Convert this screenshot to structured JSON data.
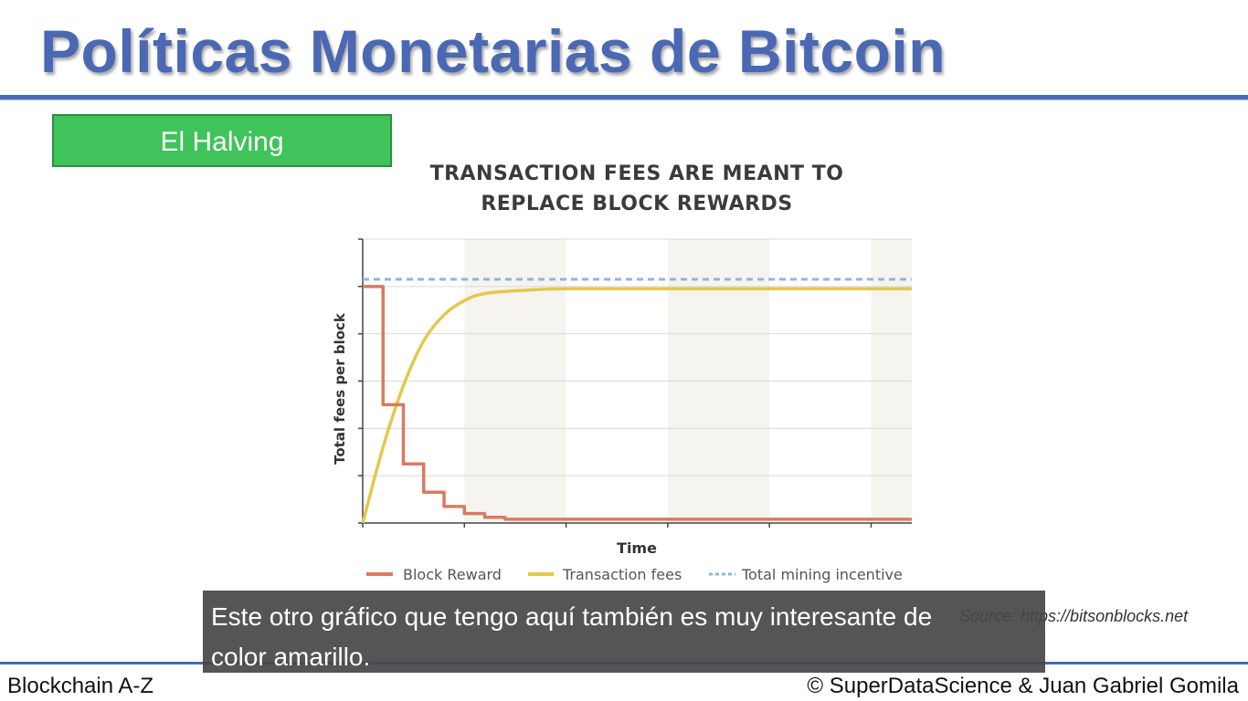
{
  "slide": {
    "title": "Políticas Monetarias de Bitcoin",
    "section_label": "El Halving",
    "source": "Source: https://bitsonblocks.net"
  },
  "footer": {
    "left": "Blockchain A-Z",
    "right": "© SuperDataScience & Juan Gabriel Gomila"
  },
  "subtitle": {
    "line1": "Este otro gráfico que tengo aquí también es muy interesante de",
    "line2": "color amarillo."
  },
  "colors": {
    "title": "#4a68b3",
    "section": "#3fc35a",
    "block_reward": "#d97a62",
    "transaction_fees": "#e3c84a",
    "total_incentive": "#8fb5de"
  },
  "chart_data": {
    "type": "line",
    "title_lines": [
      "TRANSACTION FEES ARE MEANT TO",
      "REPLACE BLOCK REWARDS"
    ],
    "xlabel": "Time",
    "ylabel": "Total fees per block",
    "xlim": [
      0,
      27
    ],
    "ylim": [
      0,
      6
    ],
    "grid": true,
    "shaded_x_bands": [
      [
        5,
        10
      ],
      [
        15,
        20
      ],
      [
        25,
        27
      ]
    ],
    "legend_position": "bottom",
    "series": [
      {
        "name": "Block Reward",
        "style": "step",
        "x": [
          0,
          1,
          1,
          2,
          2,
          3,
          3,
          4,
          4,
          5,
          5,
          6,
          6,
          7,
          7,
          8,
          8,
          27
        ],
        "y": [
          5,
          5,
          2.5,
          2.5,
          1.25,
          1.25,
          0.65,
          0.65,
          0.35,
          0.35,
          0.2,
          0.2,
          0.12,
          0.12,
          0.08,
          0.08,
          0.08,
          0.08
        ]
      },
      {
        "name": "Transaction fees",
        "style": "smooth",
        "x": [
          0,
          1,
          2,
          3,
          4,
          5,
          6,
          8,
          10,
          15,
          20,
          27
        ],
        "y": [
          0,
          1.6,
          2.9,
          3.85,
          4.4,
          4.7,
          4.85,
          4.92,
          4.95,
          4.95,
          4.95,
          4.95
        ]
      },
      {
        "name": "Total mining incentive",
        "style": "dashed",
        "x": [
          0,
          27
        ],
        "y": [
          5.15,
          5.15
        ]
      }
    ]
  }
}
